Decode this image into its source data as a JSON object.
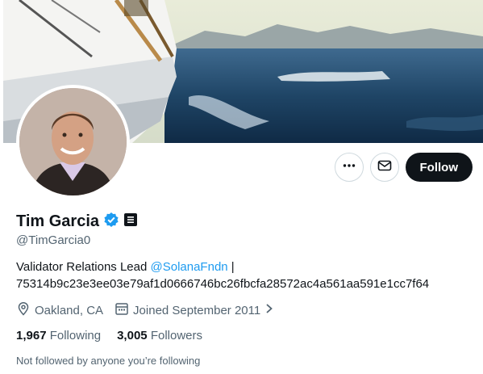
{
  "profile": {
    "name": "Tim Garcia",
    "handle": "@TimGarcia0",
    "bio_text": "Validator Relations Lead ",
    "bio_mention": "@SolanaFndn",
    "bio_separator": " |",
    "bio_line2": "75314b9c23e3ee03e79af1d0666746bc26fbcfa28572ac4a561aa591e1cc7f64",
    "location": "Oakland, CA",
    "joined": "Joined September 2011",
    "following_count": "1,967",
    "following_label": "Following",
    "followers_count": "3,005",
    "followers_label": "Followers",
    "followed_by_text": "Not followed by anyone you’re following"
  },
  "actions": {
    "more_icon": "more-horizontal-icon",
    "message_icon": "envelope-icon",
    "follow_label": "Follow"
  },
  "badges": {
    "verified_icon": "verified-check-icon",
    "verified_color": "#1d9bf0",
    "affiliate_icon": "document-badge-icon"
  },
  "icons": {
    "location": "location-pin-icon",
    "calendar": "calendar-icon",
    "chevron": "chevron-right-icon"
  }
}
